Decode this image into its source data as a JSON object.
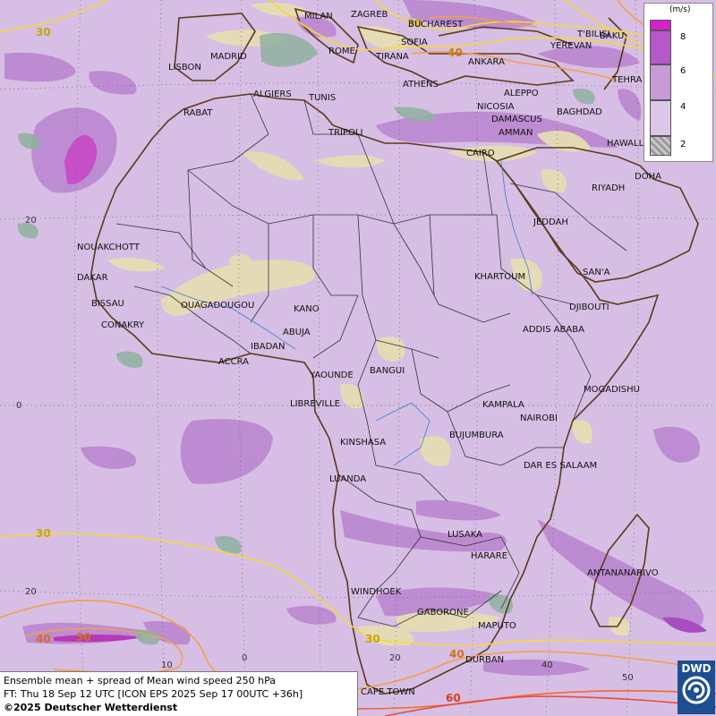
{
  "legend": {
    "unit": "(m/s)",
    "labels": [
      "8",
      "6",
      "4",
      "2"
    ],
    "colors": [
      "#d81ed0",
      "#b558c8",
      "#c89ad8",
      "#dcc7e8",
      "#9a9a9a"
    ]
  },
  "info": {
    "line1": "Ensemble mean + spread of Mean wind speed 250 hPa",
    "line2": "FT: Thu 18 Sep 12 UTC [ICON EPS 2025 Sep 17 00UTC +36h]",
    "line3": "©2025 Deutscher Wetterdienst"
  },
  "logo": {
    "text": "DWD"
  },
  "grid_labels": {
    "lat_20n": "20",
    "lat_0": "0",
    "lat_20s": "20",
    "lon_0": "0",
    "lon_10": "10",
    "lon_20": "20",
    "lon_40": "40",
    "lon_50": "50"
  },
  "isotach_labels": {
    "nw_30": "30",
    "med_40": "40",
    "med_30": "30",
    "atl_30": "30",
    "sw_40": "40",
    "sw_50": "50",
    "sa_30": "30",
    "sa_40": "40",
    "sa_60": "60"
  },
  "cities": {
    "milan": "MILAN",
    "zagreb": "ZAGREB",
    "bucharest": "BUCHAREST",
    "tbilisi": "T'BILISI",
    "baku": "BAKU",
    "yerevan": "YEREVAN",
    "madrid": "MADRID",
    "rome": "ROME",
    "sofia": "SOFIA",
    "tirana": "TIRANA",
    "ankara": "ANKARA",
    "lisbon": "LISBON",
    "algiers": "ALGIERS",
    "tunis": "TUNIS",
    "athens": "ATHENS",
    "tehran": "TEHRA",
    "rabat": "RABAT",
    "aleppo": "ALEPPO",
    "nicosia": "NICOSIA",
    "baghdad": "BAGHDAD",
    "tripoli": "TRIPOLI",
    "damascus": "DAMASCUS",
    "amman": "AMMAN",
    "hawalli": "HAWALLI",
    "cairo": "CAIRO",
    "doha": "DOHA",
    "riyadh": "RIYADH",
    "jeddah": "JEDDAH",
    "nouakchott": "NOUAKCHOTT",
    "dakar": "DAKAR",
    "khartoum": "KHARTOUM",
    "sanaa": "SAN'A",
    "bissau": "BISSAU",
    "ouagadougou": "OUAGADOUGOU",
    "kano": "KANO",
    "djibouti": "DJIBOUTI",
    "conakry": "CONAKRY",
    "abuja": "ABUJA",
    "addis": "ADDIS ABABA",
    "ibadan": "IBADAN",
    "accra": "ACCRA",
    "yaounde": "YAOUNDE",
    "bangui": "BANGUI",
    "mogadishu": "MOGADISHU",
    "libreville": "LIBREVILLE",
    "kampala": "KAMPALA",
    "nairobi": "NAIROBI",
    "kinshasa": "KINSHASA",
    "bujumbura": "BUJUMBURA",
    "dar": "DAR ES SALAAM",
    "luanda": "LUANDA",
    "lusaka": "LUSAKA",
    "harare": "HARARE",
    "antananarivo": "ANTANANARIVO",
    "windhoek": "WINDHOEK",
    "gaborone": "GABORONE",
    "maputo": "MAPUTO",
    "durban": "DURBAN",
    "capetown": "CAPE TOWN"
  }
}
